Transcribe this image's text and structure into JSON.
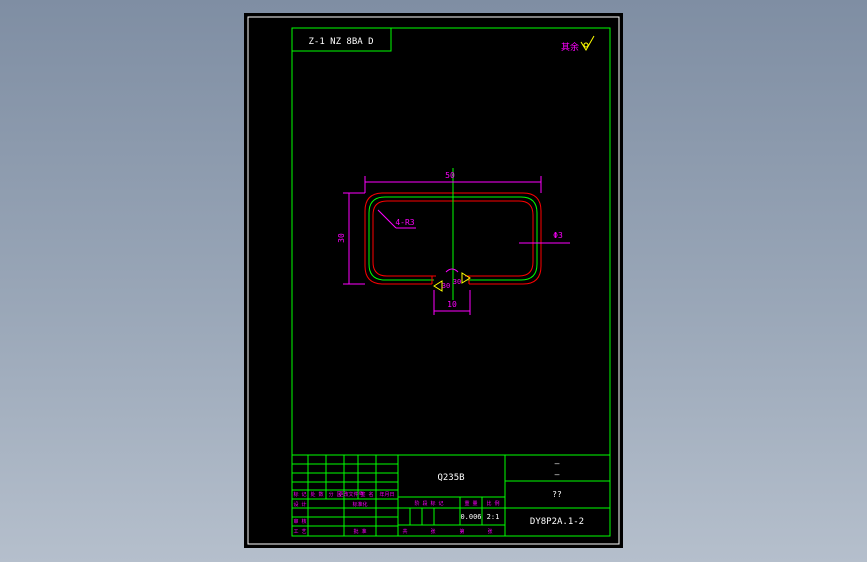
{
  "drawing": {
    "title_tab": "Z-1 NZ 8BA D",
    "roughness_label": "其余",
    "dimensions": {
      "width": "50",
      "height": "30",
      "corner_radius": "4-R3",
      "wire_dia": "Φ3",
      "gap": "10",
      "angle_left": "30",
      "angle_right": "30"
    },
    "title_block": {
      "material": "Q235B",
      "part_name_top": "—",
      "part_name_mid": "—",
      "company": "??",
      "drawing_no": "DY8P2A.1-2",
      "weight": "0.006",
      "scale": "2:1",
      "row_labels": [
        "标 记",
        "处 数",
        "分 区",
        "更改文件号",
        "签 名",
        "年月日"
      ],
      "left_labels": [
        "设 计",
        "审 核",
        "工 艺"
      ],
      "std_label": "标准化",
      "approve_label": "批 准",
      "stage_labels": [
        "阶 段 标 记",
        "重 量",
        "比 例"
      ],
      "footer_labels": [
        "共",
        "张",
        "第",
        "张"
      ]
    }
  },
  "colors": {
    "frame": "#ffffff",
    "border": "#00ff00",
    "dimension": "#ff00ff",
    "part": "#ff0000",
    "centerline": "#00ff00",
    "text": "#ffffff"
  }
}
